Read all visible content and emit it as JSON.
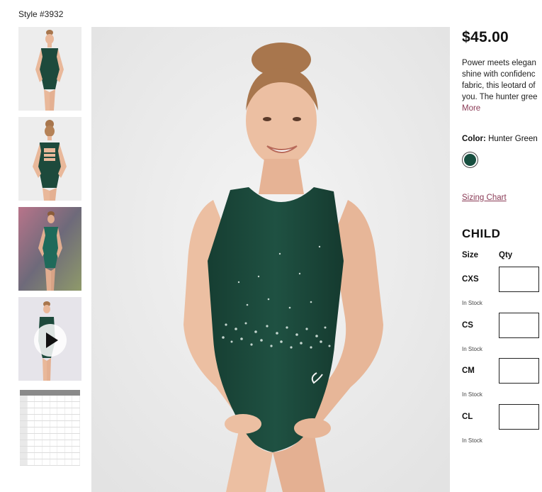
{
  "style_number": "Style #3932",
  "product": {
    "price": "$45.00",
    "description_lines": [
      "Power meets elegan",
      "shine with confidenc",
      "fabric, this leotard of",
      "you. The hunter gree"
    ],
    "more_label": "More",
    "color_label": "Color:",
    "color_value": "Hunter Green",
    "swatch_color": "#174f40",
    "sizing_chart_label": "Sizing Chart"
  },
  "sizes": {
    "section_title": "CHILD",
    "size_header": "Size",
    "qty_header": "Qty",
    "rows": [
      {
        "size": "CXS",
        "qty": "",
        "stock": "In Stock"
      },
      {
        "size": "CS",
        "qty": "",
        "stock": "In Stock"
      },
      {
        "size": "CM",
        "qty": "",
        "stock": "In Stock"
      },
      {
        "size": "CL",
        "qty": "",
        "stock": "In Stock"
      }
    ]
  },
  "colors": {
    "leotard": "#1d4a3c",
    "skin": "#e9b89a",
    "hair": "#a8764d",
    "backdrop": "#ececec",
    "accent_link": "#8a3a55"
  }
}
